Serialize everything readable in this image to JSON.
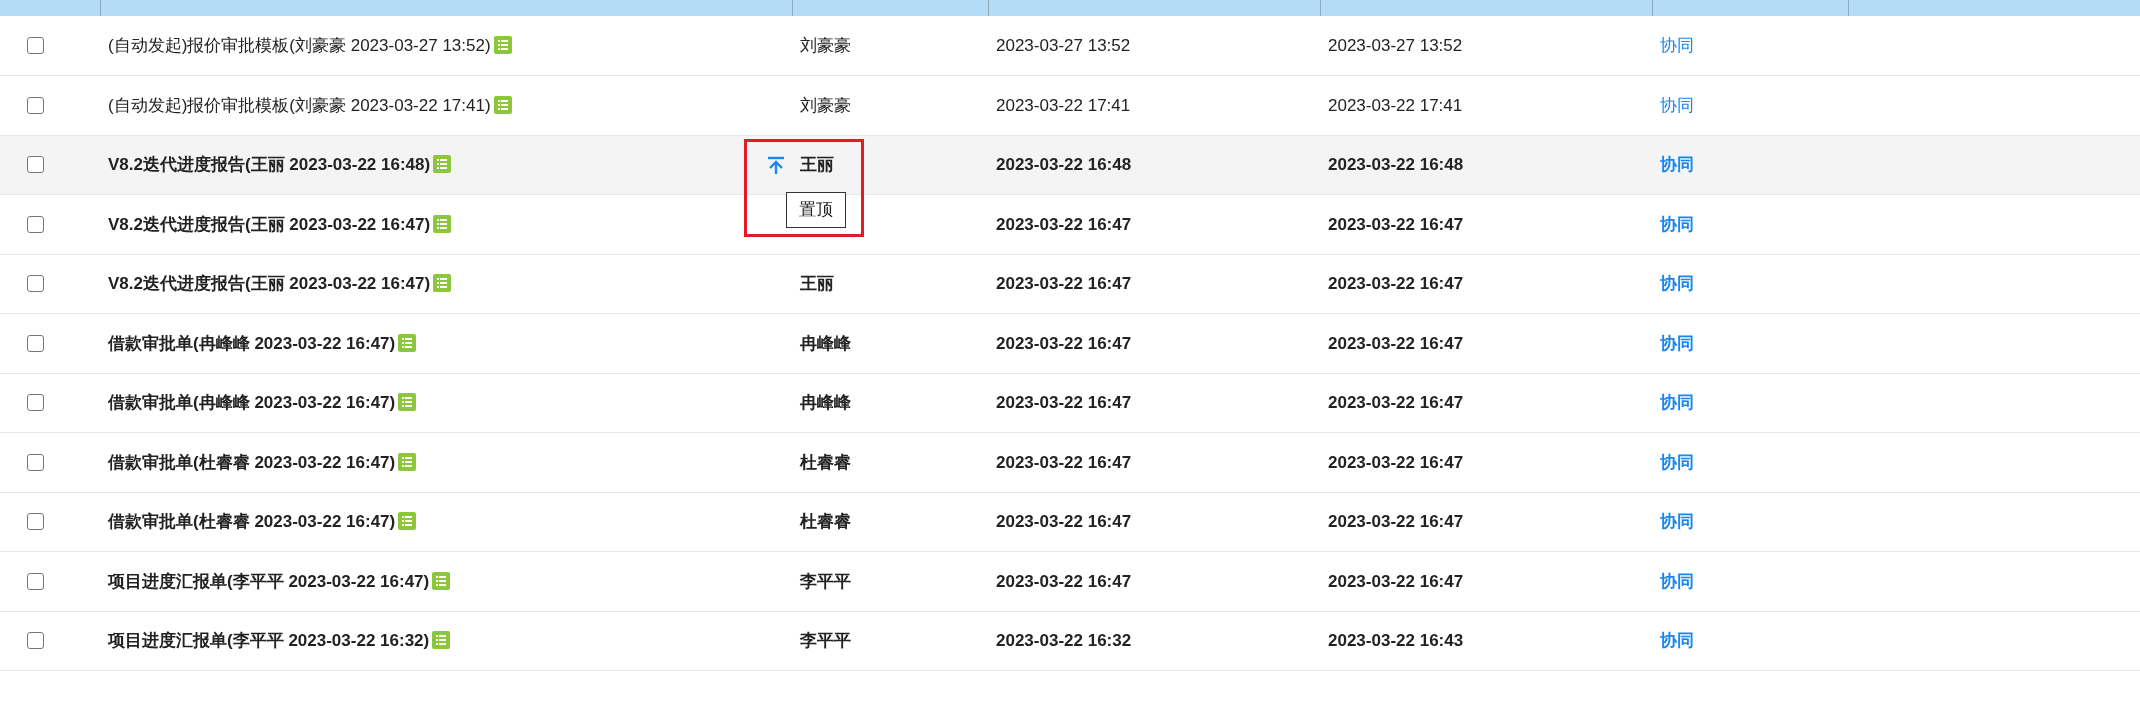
{
  "table": {
    "rows": [
      {
        "checked": false,
        "unread": false,
        "hovered": false,
        "title": "(自动发起)报价审批模板(刘豪豪 2023-03-27 13:52)",
        "sender": "刘豪豪",
        "created": "2023-03-27 13:52",
        "updated": "2023-03-27 13:52",
        "type": "协同"
      },
      {
        "checked": false,
        "unread": false,
        "hovered": false,
        "title": "(自动发起)报价审批模板(刘豪豪 2023-03-22 17:41)",
        "sender": "刘豪豪",
        "created": "2023-03-22 17:41",
        "updated": "2023-03-22 17:41",
        "type": "协同"
      },
      {
        "checked": false,
        "unread": true,
        "hovered": true,
        "title": "V8.2迭代进度报告(王丽 2023-03-22 16:48)",
        "sender": "王丽",
        "created": "2023-03-22 16:48",
        "updated": "2023-03-22 16:48",
        "type": "协同",
        "pin_tooltip": "置顶"
      },
      {
        "checked": false,
        "unread": true,
        "hovered": false,
        "title": "V8.2迭代进度报告(王丽 2023-03-22 16:47)",
        "created": "2023-03-22 16:47",
        "updated": "2023-03-22 16:47",
        "type": "协同"
      },
      {
        "checked": false,
        "unread": true,
        "hovered": false,
        "title": "V8.2迭代进度报告(王丽 2023-03-22 16:47)",
        "sender": "王丽",
        "created": "2023-03-22 16:47",
        "updated": "2023-03-22 16:47",
        "type": "协同"
      },
      {
        "checked": false,
        "unread": true,
        "hovered": false,
        "title": "借款审批单(冉峰峰 2023-03-22 16:47)",
        "sender": "冉峰峰",
        "created": "2023-03-22 16:47",
        "updated": "2023-03-22 16:47",
        "type": "协同"
      },
      {
        "checked": false,
        "unread": true,
        "hovered": false,
        "title": "借款审批单(冉峰峰 2023-03-22 16:47)",
        "sender": "冉峰峰",
        "created": "2023-03-22 16:47",
        "updated": "2023-03-22 16:47",
        "type": "协同"
      },
      {
        "checked": false,
        "unread": true,
        "hovered": false,
        "title": "借款审批单(杜睿睿 2023-03-22 16:47)",
        "sender": "杜睿睿",
        "created": "2023-03-22 16:47",
        "updated": "2023-03-22 16:47",
        "type": "协同"
      },
      {
        "checked": false,
        "unread": true,
        "hovered": false,
        "title": "借款审批单(杜睿睿 2023-03-22 16:47)",
        "sender": "杜睿睿",
        "created": "2023-03-22 16:47",
        "updated": "2023-03-22 16:47",
        "type": "协同"
      },
      {
        "checked": false,
        "unread": true,
        "hovered": false,
        "title": "项目进度汇报单(李平平 2023-03-22 16:47)",
        "sender": "李平平",
        "created": "2023-03-22 16:47",
        "updated": "2023-03-22 16:47",
        "type": "协同"
      },
      {
        "checked": false,
        "unread": true,
        "hovered": false,
        "title": "项目进度汇报单(李平平 2023-03-22 16:32)",
        "sender": "李平平",
        "created": "2023-03-22 16:32",
        "updated": "2023-03-22 16:43",
        "type": "协同"
      }
    ]
  }
}
